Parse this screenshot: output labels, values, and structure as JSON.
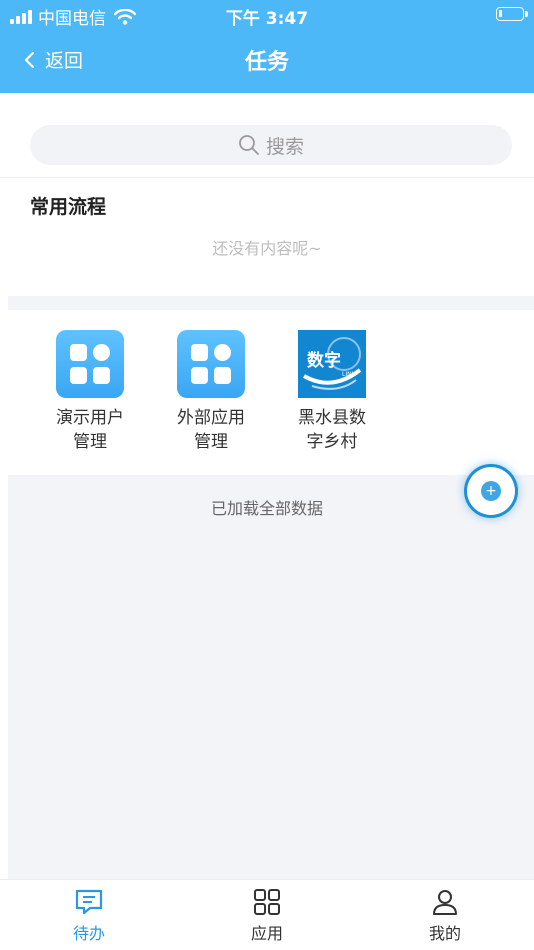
{
  "status_bar": {
    "carrier": "中国电信",
    "time": "下午 3:47"
  },
  "nav": {
    "back_label": "返回",
    "title": "任务"
  },
  "search": {
    "placeholder": "搜索"
  },
  "common_flows": {
    "title": "常用流程",
    "empty_text": "还没有内容呢~"
  },
  "apps": [
    {
      "name": "演示用户管理",
      "line1": "演示用户",
      "line2": "管理",
      "icon": "grid-app-icon"
    },
    {
      "name": "外部应用管理",
      "line1": "外部应用",
      "line2": "管理",
      "icon": "grid-app-icon"
    },
    {
      "name": "黑水县数字乡村",
      "line1": "黑水县数",
      "line2": "字乡村",
      "icon": "digital-village-logo",
      "logo_text": "数字",
      "logo_subtext": "LINK"
    }
  ],
  "list_status": "已加载全部数据",
  "tabs": [
    {
      "label": "待办",
      "icon": "message-icon",
      "active": true
    },
    {
      "label": "应用",
      "icon": "apps-grid-icon",
      "active": false
    },
    {
      "label": "我的",
      "icon": "person-icon",
      "active": false
    }
  ],
  "colors": {
    "primary": "#4db8f7",
    "active_tab": "#2b97e2",
    "background": "#f3f4f8"
  }
}
